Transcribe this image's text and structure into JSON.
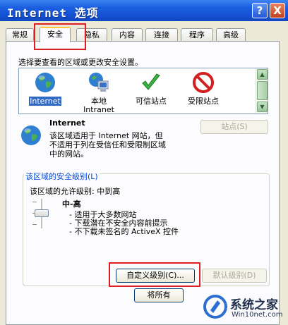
{
  "window": {
    "title": "Internet 选项",
    "help_btn": "?",
    "close_btn": "X"
  },
  "tabs": [
    {
      "label": "常规",
      "active": false
    },
    {
      "label": "安全",
      "active": true
    },
    {
      "label": "隐私",
      "active": false
    },
    {
      "label": "内容",
      "active": false
    },
    {
      "label": "连接",
      "active": false
    },
    {
      "label": "程序",
      "active": false
    },
    {
      "label": "高级",
      "active": false
    }
  ],
  "security": {
    "prompt": "选择要查看的区域或更改安全设置。",
    "zones": [
      {
        "label": "Internet",
        "icon": "globe-icon",
        "selected": true
      },
      {
        "label": "本地\nIntranet",
        "icon": "intranet-icon",
        "selected": false
      },
      {
        "label": "可信站点",
        "icon": "checkmark-icon",
        "selected": false
      },
      {
        "label": "受限站点",
        "icon": "no-entry-icon",
        "selected": false
      }
    ],
    "zone_title": "Internet",
    "zone_desc": "该区域适用于 Internet 网站，但\n不适用于列在受信任和受限制区域\n中的网站。",
    "sites_button": "站点(S)",
    "group_title": "该区域的安全级别(L)",
    "allowed_levels": "该区域的允许级别: 中到高",
    "level_name": "中-高",
    "level_bullets": [
      "- 适用于大多数网站",
      "- 下载潜在不安全内容前提示",
      "- 不下载未签名的 ActiveX 控件"
    ],
    "custom_level_button": "自定义级别(C)...",
    "default_level_button": "默认级别(D)",
    "reset_all_button": "将所有"
  },
  "watermark": {
    "brand": "系统之家",
    "url": "Win10net.com"
  },
  "colors": {
    "title_bar": "#1b5fe0",
    "highlight_red": "#e02020",
    "selection": "#316ac5",
    "group_title": "#0046d5"
  }
}
